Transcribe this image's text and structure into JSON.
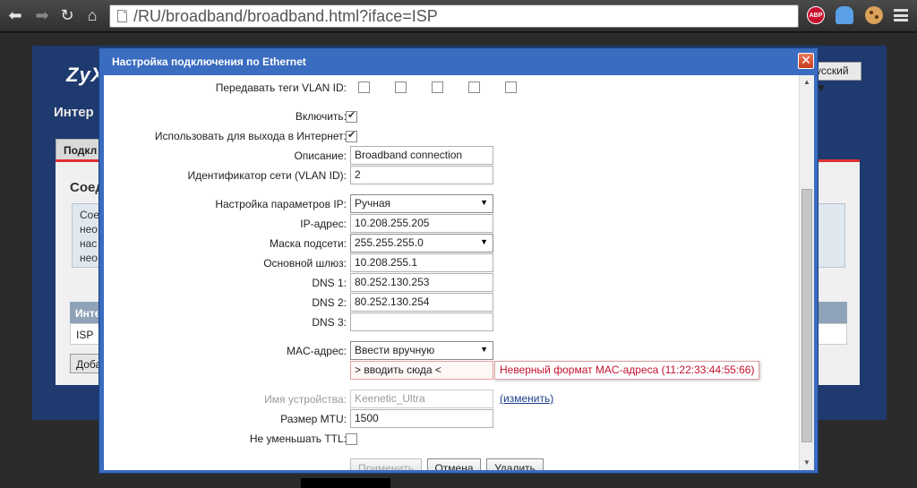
{
  "browser": {
    "url": "/RU/broadband/broadband.html?iface=ISP",
    "ext_abp_label": "ABP"
  },
  "background": {
    "logo": "ZyX",
    "heading": "Интер",
    "language": "усский",
    "tab": "Подкл",
    "section_title": "Соед",
    "info_lines": [
      "Сое",
      "нео",
      "нас",
      "нео"
    ],
    "table_header": "Инте",
    "table_row": "ISP",
    "add_button": "Доба"
  },
  "dialog": {
    "title": "Настройка подключения по Ethernet",
    "close": "✕",
    "vlan_tags_label": "Передавать теги VLAN ID:",
    "enable_label": "Включить:",
    "use_for_internet_label": "Использовать для выхода в Интернет:",
    "description_label": "Описание:",
    "description_value": "Broadband connection",
    "vlan_id_label": "Идентификатор сети (VLAN ID):",
    "vlan_id_value": "2",
    "ip_settings_label": "Настройка параметров IP:",
    "ip_settings_value": "Ручная",
    "ip_label": "IP-адрес:",
    "ip_value": "10.208.255.205",
    "mask_label": "Маска подсети:",
    "mask_value": "255.255.255.0",
    "gateway_label": "Основной шлюз:",
    "gateway_value": "10.208.255.1",
    "dns1_label": "DNS 1:",
    "dns1_value": "80.252.130.253",
    "dns2_label": "DNS 2:",
    "dns2_value": "80.252.130.254",
    "dns3_label": "DNS 3:",
    "dns3_value": "",
    "mac_label": "MAC-адрес:",
    "mac_mode_value": "Ввести вручную",
    "mac_input_value": "> вводить сюда <",
    "mac_error": "Неверный формат MAC-адреса (11:22:33:44:55:66)",
    "device_name_label": "Имя устройства:",
    "device_name_value": "Keenetic_Ultra",
    "change_link": "(изменить)",
    "mtu_label": "Размер MTU:",
    "mtu_value": "1500",
    "ttl_label": "Не уменьшать TTL:",
    "apply_button": "Применить",
    "cancel_button": "Отмена",
    "delete_button": "Удалить"
  }
}
